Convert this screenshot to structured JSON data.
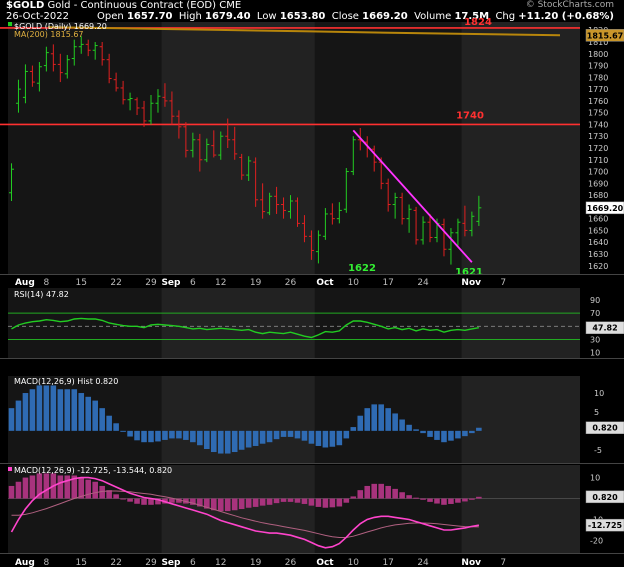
{
  "header": {
    "symbol": "$GOLD",
    "name": "Gold - Continuous Contract (EOD)",
    "exchange": "CME",
    "date": "26-Oct-2022",
    "open_label": "Open",
    "open": "1657.70",
    "high_label": "High",
    "high": "1679.40",
    "low_label": "Low",
    "low": "1653.80",
    "close_label": "Close",
    "close": "1669.20",
    "volume_label": "Volume",
    "volume": "17.5M",
    "chg_label": "Chg",
    "chg": "+11.20 (+0.68%)",
    "watermark": "© StockCharts.com"
  },
  "chart_data": [
    {
      "type": "candlestick",
      "legend": [
        "$GOLD (Daily) 1669.20",
        "MA(200) 1815.67"
      ],
      "ylim": [
        1613,
        1827
      ],
      "y_ticks": [
        1620,
        1630,
        1640,
        1650,
        1660,
        1670,
        1680,
        1690,
        1700,
        1710,
        1720,
        1730,
        1740,
        1750,
        1760,
        1770,
        1780,
        1790,
        1800,
        1810,
        1820
      ],
      "x_labels": [
        "Aug",
        "8",
        "15",
        "22",
        "29",
        "Sep",
        "6",
        "12",
        "19",
        "26",
        "Oct",
        "10",
        "17",
        "24",
        "Nov",
        "7"
      ],
      "last_price_label": "1669.20",
      "ma_label": "1815.67",
      "ma200": {
        "color": "#b8860b",
        "values": [
          1822.5,
          1821.5,
          1820.3,
          1819.1,
          1817.8,
          1816.8,
          1815.67
        ]
      },
      "annotations": [
        {
          "text": "1824",
          "kind": "level",
          "value": 1822,
          "color": "#ff3030"
        },
        {
          "text": "1740",
          "kind": "level",
          "value": 1740,
          "color": "#ff3030"
        },
        {
          "text": "1622",
          "kind": "low",
          "color": "#33ee33"
        },
        {
          "text": "1621",
          "kind": "low",
          "color": "#33ee33"
        }
      ],
      "trendline": {
        "from": 1735,
        "to": 1623,
        "color": "#ff33ff"
      },
      "candles": [
        {
          "o": 1682,
          "h": 1707,
          "l": 1675,
          "c": 1702
        },
        {
          "o": 1758,
          "h": 1778,
          "l": 1750,
          "c": 1770
        },
        {
          "o": 1763,
          "h": 1791,
          "l": 1758,
          "c": 1785
        },
        {
          "o": 1785,
          "h": 1790,
          "l": 1772,
          "c": 1776
        },
        {
          "o": 1775,
          "h": 1793,
          "l": 1768,
          "c": 1789
        },
        {
          "o": 1790,
          "h": 1806,
          "l": 1785,
          "c": 1801
        },
        {
          "o": 1800,
          "h": 1808,
          "l": 1785,
          "c": 1791
        },
        {
          "o": 1791,
          "h": 1800,
          "l": 1776,
          "c": 1784
        },
        {
          "o": 1783,
          "h": 1799,
          "l": 1779,
          "c": 1795
        },
        {
          "o": 1796,
          "h": 1812,
          "l": 1790,
          "c": 1806
        },
        {
          "o": 1806,
          "h": 1815,
          "l": 1800,
          "c": 1808
        },
        {
          "o": 1808,
          "h": 1812,
          "l": 1798,
          "c": 1803
        },
        {
          "o": 1803,
          "h": 1810,
          "l": 1795,
          "c": 1807
        },
        {
          "o": 1806,
          "h": 1810,
          "l": 1790,
          "c": 1795
        },
        {
          "o": 1795,
          "h": 1800,
          "l": 1775,
          "c": 1779
        },
        {
          "o": 1778,
          "h": 1784,
          "l": 1768,
          "c": 1771
        },
        {
          "o": 1771,
          "h": 1777,
          "l": 1757,
          "c": 1761
        },
        {
          "o": 1761,
          "h": 1767,
          "l": 1752,
          "c": 1762
        },
        {
          "o": 1761,
          "h": 1763,
          "l": 1748,
          "c": 1754
        },
        {
          "o": 1754,
          "h": 1760,
          "l": 1738,
          "c": 1743
        },
        {
          "o": 1743,
          "h": 1765,
          "l": 1740,
          "c": 1758
        },
        {
          "o": 1758,
          "h": 1770,
          "l": 1750,
          "c": 1764
        },
        {
          "o": 1763,
          "h": 1775,
          "l": 1755,
          "c": 1760
        },
        {
          "o": 1760,
          "h": 1768,
          "l": 1740,
          "c": 1747
        },
        {
          "o": 1747,
          "h": 1752,
          "l": 1728,
          "c": 1738
        },
        {
          "o": 1738,
          "h": 1742,
          "l": 1712,
          "c": 1718
        },
        {
          "o": 1718,
          "h": 1733,
          "l": 1712,
          "c": 1727
        },
        {
          "o": 1727,
          "h": 1732,
          "l": 1700,
          "c": 1710
        },
        {
          "o": 1710,
          "h": 1728,
          "l": 1708,
          "c": 1723
        },
        {
          "o": 1722,
          "h": 1735,
          "l": 1712,
          "c": 1714
        },
        {
          "o": 1714,
          "h": 1734,
          "l": 1710,
          "c": 1730
        },
        {
          "o": 1730,
          "h": 1745,
          "l": 1720,
          "c": 1727
        },
        {
          "o": 1727,
          "h": 1738,
          "l": 1710,
          "c": 1715
        },
        {
          "o": 1712,
          "h": 1715,
          "l": 1693,
          "c": 1697
        },
        {
          "o": 1697,
          "h": 1713,
          "l": 1692,
          "c": 1709
        },
        {
          "o": 1708,
          "h": 1712,
          "l": 1670,
          "c": 1676
        },
        {
          "o": 1676,
          "h": 1690,
          "l": 1660,
          "c": 1666
        },
        {
          "o": 1665,
          "h": 1682,
          "l": 1663,
          "c": 1679
        },
        {
          "o": 1679,
          "h": 1687,
          "l": 1664,
          "c": 1672
        },
        {
          "o": 1672,
          "h": 1678,
          "l": 1660,
          "c": 1667
        },
        {
          "o": 1666,
          "h": 1680,
          "l": 1660,
          "c": 1675
        },
        {
          "o": 1675,
          "h": 1678,
          "l": 1653,
          "c": 1656
        },
        {
          "o": 1656,
          "h": 1663,
          "l": 1640,
          "c": 1645
        },
        {
          "o": 1645,
          "h": 1650,
          "l": 1625,
          "c": 1633
        },
        {
          "o": 1632,
          "h": 1650,
          "l": 1622,
          "c": 1646
        },
        {
          "o": 1645,
          "h": 1669,
          "l": 1642,
          "c": 1664
        },
        {
          "o": 1664,
          "h": 1673,
          "l": 1655,
          "c": 1660
        },
        {
          "o": 1660,
          "h": 1674,
          "l": 1656,
          "c": 1667
        },
        {
          "o": 1668,
          "h": 1703,
          "l": 1665,
          "c": 1700
        },
        {
          "o": 1700,
          "h": 1730,
          "l": 1697,
          "c": 1727
        },
        {
          "o": 1727,
          "h": 1737,
          "l": 1718,
          "c": 1726
        },
        {
          "o": 1725,
          "h": 1730,
          "l": 1712,
          "c": 1720
        },
        {
          "o": 1719,
          "h": 1722,
          "l": 1700,
          "c": 1708
        },
        {
          "o": 1708,
          "h": 1712,
          "l": 1685,
          "c": 1690
        },
        {
          "o": 1690,
          "h": 1694,
          "l": 1666,
          "c": 1672
        },
        {
          "o": 1672,
          "h": 1682,
          "l": 1660,
          "c": 1678
        },
        {
          "o": 1678,
          "h": 1682,
          "l": 1655,
          "c": 1660
        },
        {
          "o": 1660,
          "h": 1672,
          "l": 1648,
          "c": 1668
        },
        {
          "o": 1667,
          "h": 1670,
          "l": 1638,
          "c": 1642
        },
        {
          "o": 1642,
          "h": 1662,
          "l": 1638,
          "c": 1657
        },
        {
          "o": 1657,
          "h": 1664,
          "l": 1640,
          "c": 1644
        },
        {
          "o": 1644,
          "h": 1660,
          "l": 1640,
          "c": 1656
        },
        {
          "o": 1655,
          "h": 1660,
          "l": 1628,
          "c": 1634
        },
        {
          "o": 1634,
          "h": 1652,
          "l": 1621,
          "c": 1648
        },
        {
          "o": 1648,
          "h": 1660,
          "l": 1637,
          "c": 1657
        },
        {
          "o": 1656,
          "h": 1671,
          "l": 1645,
          "c": 1650
        },
        {
          "o": 1650,
          "h": 1666,
          "l": 1645,
          "c": 1662
        },
        {
          "o": 1657.7,
          "h": 1679.4,
          "l": 1653.8,
          "c": 1669.2
        }
      ]
    },
    {
      "type": "line",
      "legend": "RSI(14) 47.82",
      "ylim": [
        2,
        108
      ],
      "y_ticks": [
        10,
        30,
        50,
        70,
        90
      ],
      "levels": [
        30,
        70
      ],
      "last_label": "47.82",
      "values": [
        46,
        52,
        55,
        57,
        58,
        60,
        59,
        57,
        58,
        61,
        62,
        61,
        61,
        59,
        55,
        53,
        51,
        50,
        50,
        48,
        52,
        53,
        52,
        51,
        50,
        48,
        46,
        47,
        45,
        46,
        47,
        46,
        45,
        44,
        45,
        41,
        39,
        41,
        40,
        39,
        41,
        38,
        35,
        33,
        37,
        42,
        41,
        43,
        52,
        58,
        58,
        56,
        53,
        50,
        46,
        48,
        45,
        47,
        43,
        46,
        44,
        45,
        41,
        44,
        45,
        44,
        46,
        47.82
      ]
    },
    {
      "type": "bar",
      "legend": "MACD(12,26,9) Hist 0.820",
      "ylim": [
        -8.5,
        14.5
      ],
      "y_ticks": [
        -5,
        0,
        5,
        10
      ],
      "last_label": "0.820",
      "values": [
        6,
        8,
        10,
        11,
        12,
        12,
        12,
        11,
        11,
        11,
        10,
        9,
        8,
        6,
        4,
        2,
        0,
        -1.5,
        -2.5,
        -3,
        -3,
        -2.8,
        -2.4,
        -2,
        -2,
        -2.4,
        -3,
        -3.8,
        -4.8,
        -5.6,
        -6,
        -6,
        -5.6,
        -5,
        -4.4,
        -4,
        -3.4,
        -3,
        -2.2,
        -1.6,
        -1.6,
        -2,
        -2.6,
        -3.4,
        -4,
        -4.4,
        -4.2,
        -3.8,
        -2,
        1,
        4,
        6,
        7,
        7,
        6,
        4.6,
        3,
        1.6,
        0.4,
        -0.6,
        -1.6,
        -2.4,
        -3,
        -2.6,
        -2,
        -1.4,
        -0.6,
        0.82
      ]
    },
    {
      "type": "line+bar",
      "legend": "MACD(12,26,9) -12.725, -13.544, 0.820",
      "ylim": [
        -26,
        16
      ],
      "y_ticks": [
        -20,
        -10,
        0,
        10
      ],
      "last_labels": [
        "0.820",
        "-12.725"
      ],
      "macd": [
        -16,
        -10,
        -5,
        -1,
        2,
        4,
        6,
        7.5,
        8.5,
        9.5,
        10,
        10,
        9.5,
        8.5,
        7,
        5.5,
        4,
        2.5,
        1.5,
        0.5,
        0,
        -0.5,
        -1.5,
        -2.5,
        -3.5,
        -4.5,
        -5.5,
        -6.5,
        -7.5,
        -9,
        -10.5,
        -11.5,
        -12.5,
        -13.5,
        -14.5,
        -15.5,
        -16,
        -16.5,
        -16.5,
        -17,
        -17.5,
        -18.5,
        -19.5,
        -21,
        -22.5,
        -23.5,
        -23,
        -21.5,
        -18.5,
        -15,
        -12,
        -10,
        -9,
        -8.5,
        -8.5,
        -9,
        -9.5,
        -10,
        -11,
        -12,
        -13,
        -14,
        -15,
        -15,
        -14.5,
        -14,
        -13.3,
        -12.725
      ],
      "signal": [
        -8,
        -8,
        -7.6,
        -6.8,
        -5.8,
        -4.8,
        -3.6,
        -2.4,
        -1.2,
        0,
        1,
        2,
        2.8,
        3.4,
        3.6,
        3.6,
        3.4,
        3.2,
        2.8,
        2.4,
        2,
        1.4,
        0.8,
        0.2,
        -0.6,
        -1.4,
        -2.2,
        -3.2,
        -4.2,
        -5.2,
        -6.2,
        -7.2,
        -8.2,
        -9.2,
        -10,
        -10.8,
        -11.6,
        -12.2,
        -12.8,
        -13.4,
        -14,
        -14.6,
        -15.2,
        -16,
        -16.8,
        -17.6,
        -18.2,
        -18.6,
        -18.6,
        -18,
        -17,
        -16,
        -15,
        -14,
        -13.2,
        -12.6,
        -12.2,
        -11.8,
        -11.7,
        -11.7,
        -11.8,
        -12,
        -12.4,
        -12.8,
        -13.1,
        -13.4,
        -13.5,
        -13.544
      ],
      "hist": [
        6,
        8,
        10,
        11,
        12,
        12,
        12,
        11,
        11,
        11,
        10,
        9,
        8,
        6,
        4,
        2,
        0,
        -1.5,
        -2.5,
        -3,
        -3,
        -2.8,
        -2.4,
        -2,
        -2,
        -2.4,
        -3,
        -3.8,
        -4.8,
        -5.6,
        -6,
        -6,
        -5.6,
        -5,
        -4.4,
        -4,
        -3.4,
        -3,
        -2.2,
        -1.6,
        -1.6,
        -2,
        -2.6,
        -3.4,
        -4,
        -4.4,
        -4.2,
        -3.8,
        -2,
        1,
        4,
        6,
        7,
        7,
        6,
        4.6,
        3,
        1.6,
        0.4,
        -0.6,
        -1.6,
        -2.4,
        -3,
        -2.6,
        -2,
        -1.4,
        -0.6,
        0.82
      ]
    }
  ]
}
